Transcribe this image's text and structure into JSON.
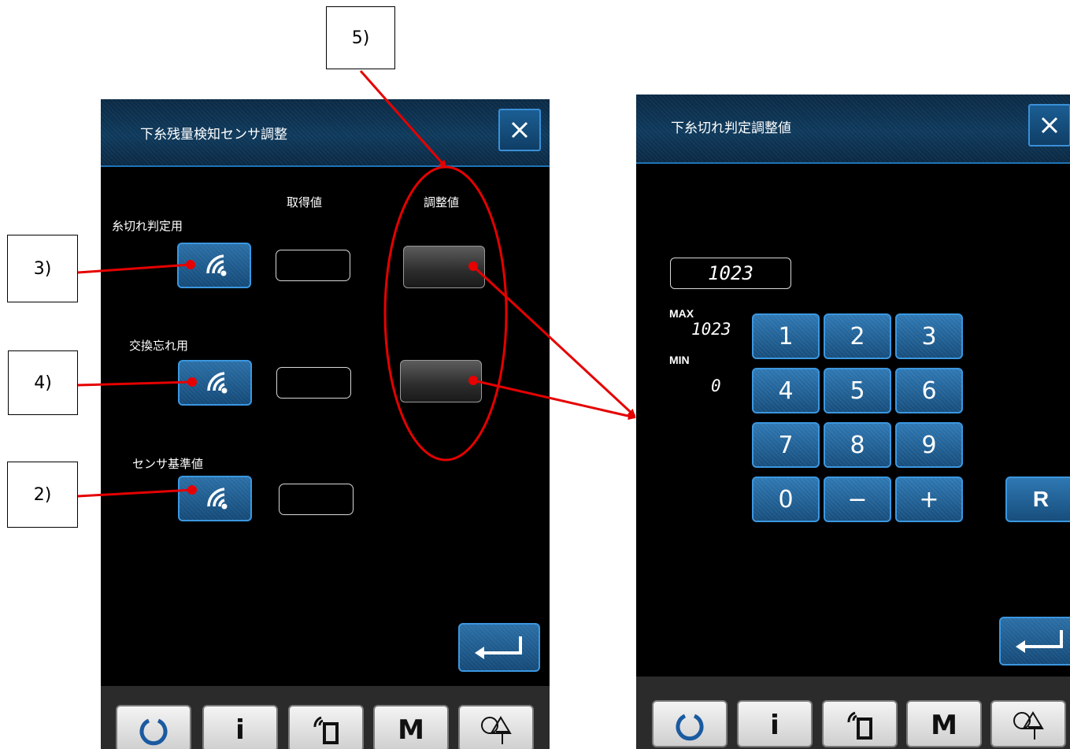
{
  "left_screen": {
    "title": "下糸残量検知センサ調整",
    "col_acquired": "取得値",
    "col_adjust": "調整値",
    "rows": [
      {
        "label": "糸切れ判定用"
      },
      {
        "label": "交換忘れ用"
      },
      {
        "label": "センサ基準値"
      }
    ]
  },
  "right_screen": {
    "title": "下糸切れ判定調整値",
    "display_value": "1023",
    "max_label": "MAX",
    "max_value": "1023",
    "min_label": "MIN",
    "min_value": "0",
    "keys": [
      "1",
      "2",
      "3",
      "4",
      "5",
      "6",
      "7",
      "8",
      "9",
      "0",
      "−",
      "+"
    ],
    "reset_label": "R"
  },
  "toolbar": {
    "info_label": "i",
    "memory_label": "M"
  },
  "callouts": {
    "c5": "5)",
    "c3": "3)",
    "c4": "4)",
    "c2": "2)"
  },
  "colors": {
    "annotation": "#e60000",
    "button_blue": "#2b6fa6",
    "titlebar": "#0f3a5c"
  }
}
